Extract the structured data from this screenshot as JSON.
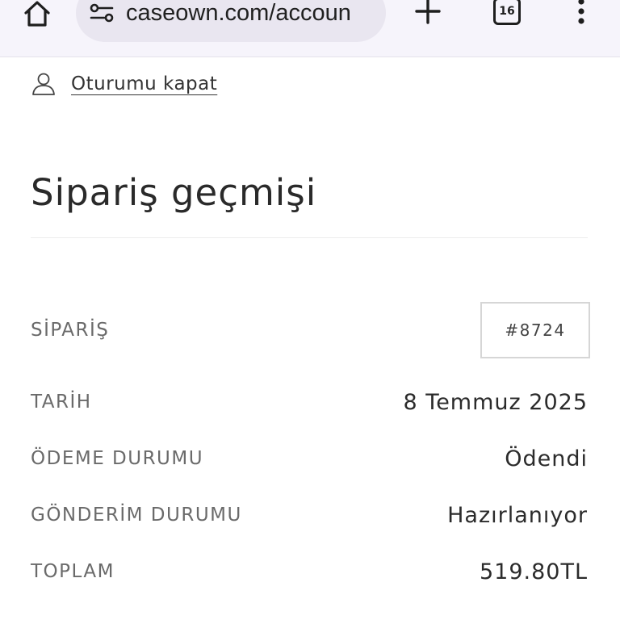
{
  "browser": {
    "url": "caseown.com/accoun",
    "tab_count": "16",
    "icons": {
      "home": "home-icon",
      "site_settings": "site-settings-icon",
      "new_tab": "plus-icon",
      "tabs": "tab-switcher-icon",
      "menu": "more-vert-icon"
    }
  },
  "account": {
    "logout_label": "Oturumu kapat",
    "logout_icon": "user-icon"
  },
  "order_history": {
    "title": "Sipariş geçmişi",
    "order": {
      "label": "SİPARİŞ",
      "number": "#8724"
    },
    "date": {
      "label": "TARİH",
      "value": "8 Temmuz 2025"
    },
    "payment_status": {
      "label": "ÖDEME DURUMU",
      "value": "Ödendi"
    },
    "shipping_status": {
      "label": "GÖNDERİM DURUMU",
      "value": "Hazırlanıyor"
    },
    "total": {
      "label": "TOPLAM",
      "value": "519.80TL"
    }
  },
  "colors": {
    "toolbar_bg": "#f6f4fb",
    "url_pill_bg": "#e9e6f0",
    "text_primary": "#2b2b2b",
    "text_label": "#6a6a6a",
    "border": "#d6d6d6"
  }
}
